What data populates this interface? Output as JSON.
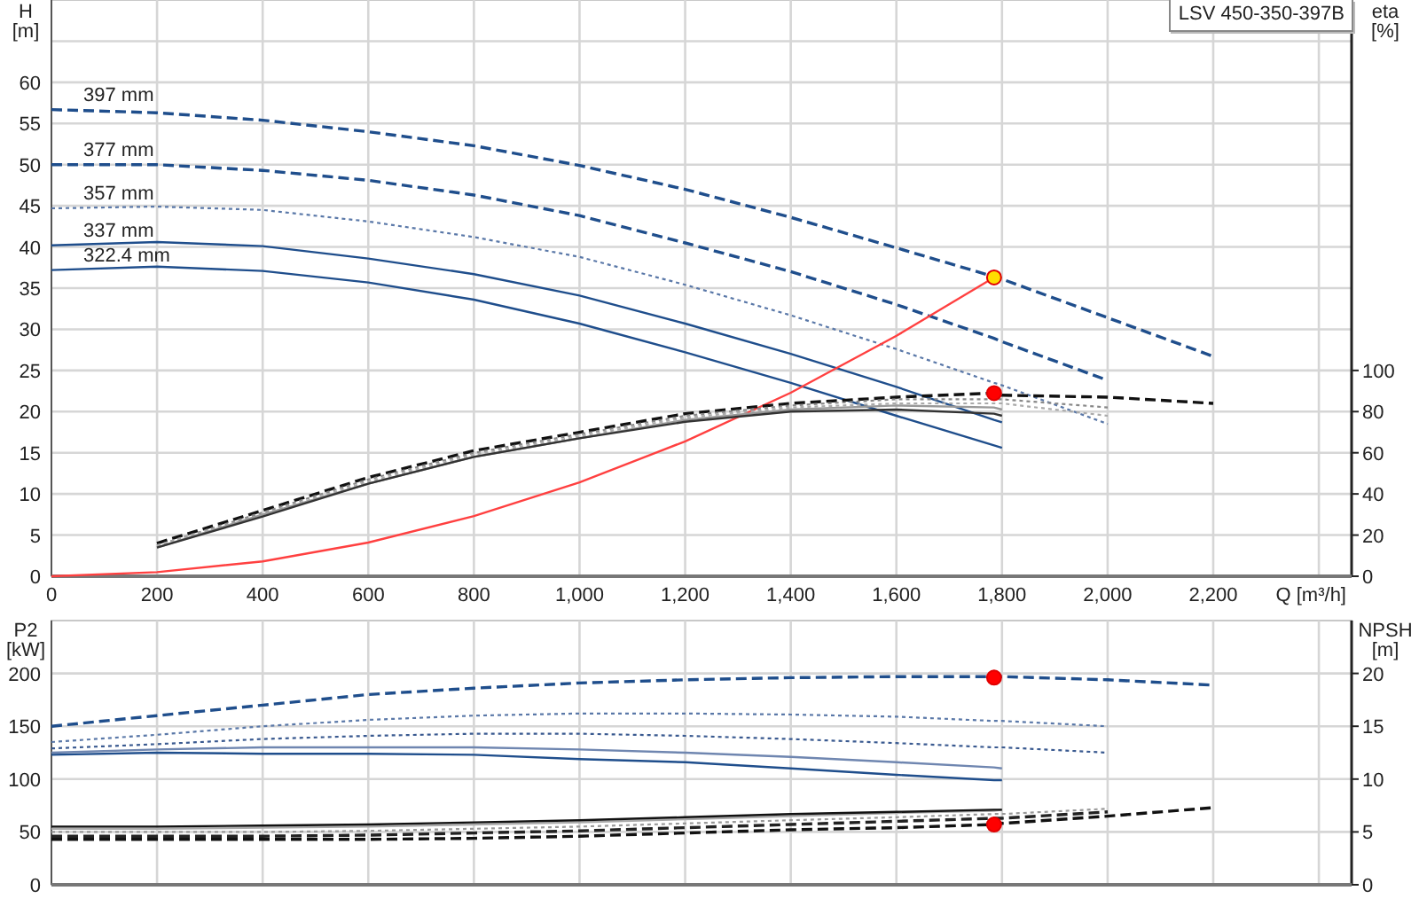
{
  "legend": {
    "label": "LSV 450-350-397B"
  },
  "head_chart": {
    "chart_data": {
      "type": "line",
      "ylabel": "H [m]",
      "xlabel": "Q [m³/h]",
      "grid": true,
      "xlim": [
        0,
        2462
      ],
      "ylim": [
        0,
        70
      ],
      "xticks": [
        0,
        200,
        400,
        600,
        800,
        {
          "value": 1000,
          "label": "1,000"
        },
        {
          "value": 1200,
          "label": "1,200"
        },
        {
          "value": 1400,
          "label": "1,400"
        },
        {
          "value": 1600,
          "label": "1,600"
        },
        {
          "value": 1800,
          "label": "1,800"
        },
        {
          "value": 2000,
          "label": "2,000"
        },
        {
          "value": 2200,
          "label": "2,200"
        }
      ],
      "yticks": [
        0,
        5,
        10,
        15,
        20,
        25,
        30,
        35,
        40,
        45,
        50,
        55,
        60
      ],
      "x": [
        0,
        200,
        400,
        600,
        800,
        1000,
        1200,
        1400,
        1600,
        1785,
        1800,
        2000,
        2200
      ],
      "series": [
        {
          "name": "397 mm",
          "line_style": "dashed",
          "color": "#1f4e8c",
          "values": [
            56.7,
            56.3,
            55.4,
            54,
            52.3,
            49.9,
            47,
            43.6,
            39.9,
            36.4,
            36.1,
            31.4,
            26.7
          ]
        },
        {
          "name": "377 mm",
          "line_style": "dashed",
          "color": "#1f4e8c",
          "values": [
            50,
            50,
            49.3,
            48.1,
            46.3,
            43.8,
            40.5,
            37,
            33,
            28.9,
            28.5,
            23.8,
            null
          ]
        },
        {
          "name": "357 mm",
          "line_style": "dotted",
          "color": "#5a78a8",
          "values": [
            44.7,
            44.9,
            44.5,
            43.1,
            41.2,
            38.8,
            35.4,
            31.7,
            27.6,
            23.5,
            23.2,
            18.5,
            null
          ]
        },
        {
          "name": "337 mm",
          "color": "#1f4e8c",
          "values": [
            40.2,
            40.6,
            40.1,
            38.6,
            36.7,
            34.1,
            30.7,
            27,
            23,
            19,
            18.7,
            null,
            null
          ]
        },
        {
          "name": "322.4 mm",
          "color": "#1f4e8c",
          "values": [
            37.2,
            37.6,
            37.1,
            35.7,
            33.6,
            30.7,
            27.2,
            23.5,
            19.5,
            15.9,
            15.6,
            null,
            null
          ]
        },
        {
          "color": "#ff4040",
          "values": [
            0,
            0.5,
            1.8,
            4.1,
            7.3,
            11.4,
            16.4,
            22.3,
            29.2,
            36.3,
            null,
            null,
            null
          ]
        },
        {
          "color": "#ffdd00",
          "marker": "circle",
          "values": [
            null,
            null,
            null,
            null,
            null,
            null,
            null,
            null,
            null,
            36.3,
            null,
            null,
            null
          ]
        }
      ]
    }
  },
  "efficiency_chart": {
    "chart_data": {
      "type": "line",
      "ylabel": "eta [%]",
      "xlim": [
        0,
        2462
      ],
      "ylim": [
        0,
        280
      ],
      "yticks": [
        0,
        20,
        40,
        60,
        80,
        100
      ],
      "x": [
        200,
        400,
        600,
        800,
        1000,
        1200,
        1400,
        1600,
        1785,
        1800,
        2000,
        2200
      ],
      "series": [
        {
          "line_style": "dashed",
          "color": "#111111",
          "values": [
            16,
            32,
            48,
            61,
            70,
            79,
            84,
            87,
            89,
            88,
            87,
            84
          ]
        },
        {
          "line_style": "dotted",
          "color": "#888888",
          "values": [
            15,
            31,
            47,
            60,
            69,
            78,
            83,
            86,
            86,
            86,
            82,
            null
          ]
        },
        {
          "line_style": "dotted",
          "color": "#aaaaaa",
          "values": [
            15,
            30,
            46,
            59,
            68,
            77,
            82,
            84,
            84,
            84,
            78,
            null
          ]
        },
        {
          "color": "#999999",
          "values": [
            14,
            30,
            45,
            58,
            67,
            76,
            81,
            83,
            82,
            81,
            null,
            null
          ]
        },
        {
          "color": "#333333",
          "values": [
            14,
            29,
            45,
            58,
            67,
            75,
            80,
            81,
            79,
            78,
            null,
            null
          ]
        },
        {
          "color": "#ff0000",
          "marker": "circle",
          "values": [
            null,
            null,
            null,
            null,
            null,
            null,
            null,
            null,
            89,
            null,
            null,
            null
          ]
        }
      ]
    }
  },
  "power_chart": {
    "chart_data": {
      "type": "line",
      "ylabel": "P2 [kW]",
      "grid": true,
      "xlim": [
        0,
        2462
      ],
      "ylim": [
        0,
        250
      ],
      "yticks": [
        0,
        50,
        100,
        150,
        200
      ],
      "x": [
        0,
        200,
        400,
        600,
        800,
        1000,
        1200,
        1400,
        1600,
        1785,
        1800,
        2000,
        2200
      ],
      "series": [
        {
          "line_style": "dashed",
          "color": "#1f4e8c",
          "values": [
            150,
            160,
            170,
            180,
            186,
            191,
            194,
            196,
            197,
            197,
            197,
            194,
            189
          ]
        },
        {
          "line_style": "dotted",
          "color": "#5a78a8",
          "values": [
            135,
            142,
            150,
            156,
            160,
            162,
            162,
            161,
            159,
            155,
            155,
            150,
            null
          ]
        },
        {
          "line_style": "dotted",
          "color": "#3a5a90",
          "values": [
            129,
            133,
            138,
            141,
            143,
            143,
            141,
            138,
            134,
            130,
            130,
            125,
            null
          ]
        },
        {
          "color": "#6f86b0",
          "values": [
            125,
            128,
            130,
            130,
            130,
            128,
            125,
            121,
            116,
            111,
            110,
            null,
            null
          ]
        },
        {
          "color": "#1f4e8c",
          "values": [
            123,
            125,
            124,
            124,
            123,
            119,
            116,
            110,
            104,
            99,
            99,
            null,
            null
          ]
        },
        {
          "color": "#ff0000",
          "marker": "circle",
          "values": [
            null,
            null,
            null,
            null,
            null,
            null,
            null,
            null,
            null,
            196,
            null,
            null,
            null
          ]
        }
      ]
    }
  },
  "npsh_chart": {
    "chart_data": {
      "type": "line",
      "ylabel": "NPSH [m]",
      "xlim": [
        0,
        2462
      ],
      "ylim": [
        0,
        25
      ],
      "yticks": [
        0,
        5,
        10,
        15,
        20
      ],
      "x": [
        0,
        200,
        400,
        600,
        800,
        1000,
        1200,
        1400,
        1600,
        1785,
        1800,
        2000,
        2200
      ],
      "series": [
        {
          "line_style": "dashed",
          "color": "#111111",
          "values": [
            4.3,
            4.3,
            4.3,
            4.3,
            4.4,
            4.6,
            4.9,
            5.2,
            5.4,
            5.7,
            5.8,
            6.5,
            7.3
          ]
        },
        {
          "line_style": "dashed",
          "color": "#222222",
          "values": [
            4.6,
            4.6,
            4.6,
            4.7,
            4.9,
            5.1,
            5.4,
            5.7,
            6,
            6.3,
            6.3,
            6.9,
            null
          ]
        },
        {
          "line_style": "dotted",
          "color": "#999999",
          "values": [
            5,
            5,
            5,
            5.1,
            5.3,
            5.5,
            5.8,
            6.1,
            6.4,
            6.7,
            6.7,
            7.2,
            null
          ]
        },
        {
          "color": "#aaaaaa",
          "values": [
            5.3,
            5.3,
            5.4,
            5.5,
            5.7,
            5.9,
            6.2,
            6.5,
            6.8,
            7,
            7.1,
            null,
            null
          ]
        },
        {
          "color": "#111111",
          "values": [
            5.5,
            5.5,
            5.6,
            5.7,
            5.9,
            6.1,
            6.4,
            6.7,
            6.9,
            7.1,
            7.1,
            null,
            null
          ]
        },
        {
          "color": "#ff0000",
          "marker": "circle",
          "values": [
            null,
            null,
            null,
            null,
            null,
            null,
            null,
            null,
            null,
            5.7,
            null,
            null,
            null
          ]
        }
      ]
    }
  }
}
